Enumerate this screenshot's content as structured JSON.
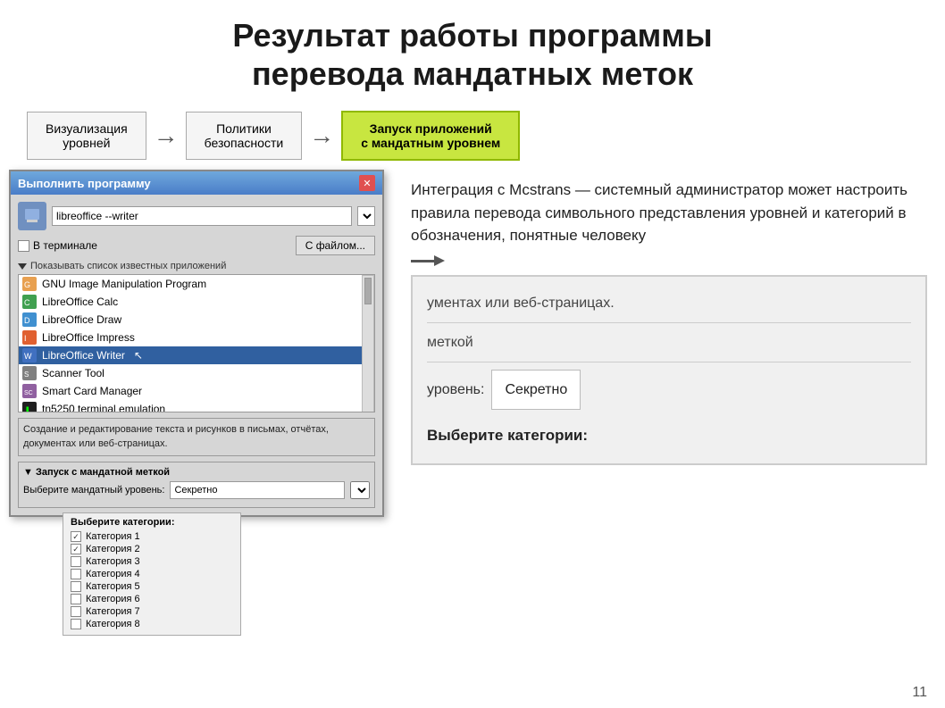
{
  "title": {
    "line1": "Результат работы программы",
    "line2": "перевода мандатных меток"
  },
  "steps": [
    {
      "id": "step1",
      "label": "Визуализация\nуровней",
      "active": false
    },
    {
      "id": "step2",
      "label": "Политики\nбезопасности",
      "active": false
    },
    {
      "id": "step3",
      "label": "Запуск приложений\nс мандатным уровнем",
      "active": true
    }
  ],
  "dialog": {
    "title": "Выполнить программу",
    "input_value": "libreoffice --writer",
    "terminal_checkbox": "В терминале",
    "file_button": "С файлом...",
    "app_list_label": "Показывать список известных приложений",
    "apps": [
      {
        "name": "GNU Image Manipulation Program",
        "icon": "image"
      },
      {
        "name": "LibreOffice Calc",
        "icon": "calc"
      },
      {
        "name": "LibreOffice Draw",
        "icon": "draw"
      },
      {
        "name": "LibreOffice Impress",
        "icon": "impress"
      },
      {
        "name": "LibreOffice Writer",
        "icon": "writer",
        "selected": true
      },
      {
        "name": "Scanner Tool",
        "icon": "scanner"
      },
      {
        "name": "Smart Card Manager",
        "icon": "smartcard"
      },
      {
        "name": "tn5250 terminal emulation",
        "icon": "terminal"
      }
    ],
    "description": "Создание и редактирование текста и рисунков в письмах, отчётах, документах или веб-страницах.",
    "mandatory_section": {
      "title": "▼ Запуск с мандатной меткой",
      "level_label": "Выберите мандатный уровень:",
      "level_value": "Секретно",
      "category_label": "Выберите категории:"
    }
  },
  "categories": [
    {
      "name": "Категория 1",
      "checked": true
    },
    {
      "name": "Категория 2",
      "checked": true
    },
    {
      "name": "Категория 3",
      "checked": false
    },
    {
      "name": "Категория 4",
      "checked": false
    },
    {
      "name": "Категория 5",
      "checked": false
    },
    {
      "name": "Категория 6",
      "checked": false
    },
    {
      "name": "Категория 7",
      "checked": false
    },
    {
      "name": "Категория 8",
      "checked": false
    }
  ],
  "info_text": "Интеграция с Mcstrans — системный администратор может настроить правила перевода символьного представления уровней и категорий в обозначения, понятные человеку",
  "zoomed": {
    "lines": [
      "ументах или веб-страницах.",
      "меткой"
    ],
    "level_label": "уровень:",
    "level_value": "Секретно",
    "category_label": "Выберите категории:"
  },
  "page_number": "11"
}
